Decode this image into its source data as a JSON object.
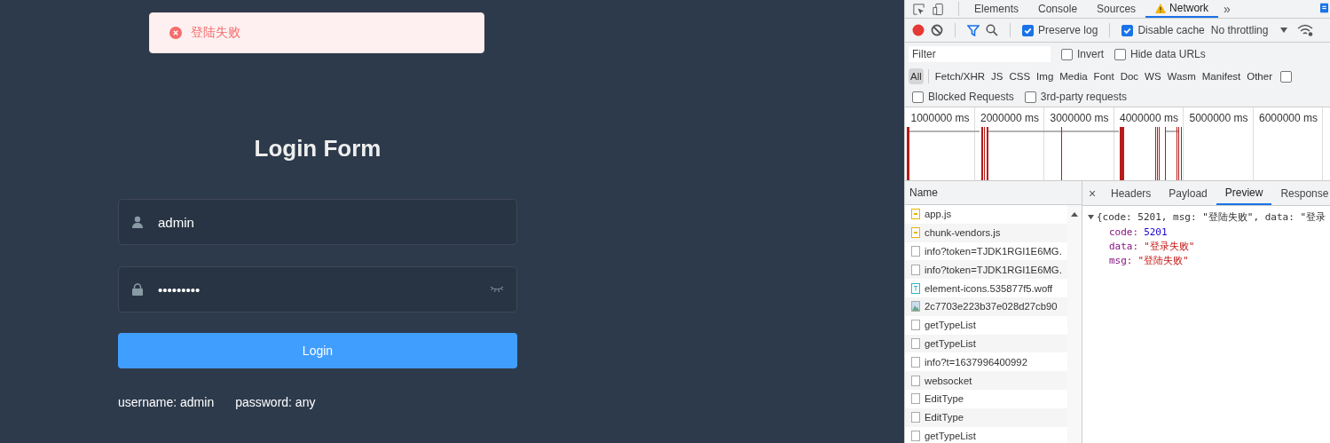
{
  "toast": {
    "kind": "error",
    "text": "登陆失败"
  },
  "login": {
    "title": "Login Form",
    "fields": [
      {
        "kind": "user",
        "value": "admin"
      },
      {
        "kind": "password",
        "value": "•••••••••",
        "show_toggle": true
      }
    ],
    "button": "Login",
    "hints": [
      "username: admin",
      "password: any"
    ]
  },
  "devtools": {
    "tabs": [
      {
        "label": "Elements",
        "selected": false,
        "warning": false
      },
      {
        "label": "Console",
        "selected": false,
        "warning": false
      },
      {
        "label": "Sources",
        "selected": false,
        "warning": false
      },
      {
        "label": "Network",
        "selected": true,
        "warning": true
      }
    ],
    "more_tabs": "»",
    "toolbar": {
      "recording": true,
      "preserve_log": {
        "label": "Preserve log",
        "checked": true
      },
      "disable_cache": {
        "label": "Disable cache",
        "checked": true
      },
      "throttling": "No throttling"
    },
    "filter": {
      "placeholder": "Filter",
      "invert": {
        "label": "Invert",
        "checked": false
      },
      "hide_data_urls": {
        "label": "Hide data URLs",
        "checked": false
      }
    },
    "types": [
      {
        "label": "All",
        "selected": true
      },
      {
        "label": "Fetch/XHR",
        "selected": false
      },
      {
        "label": "JS",
        "selected": false
      },
      {
        "label": "CSS",
        "selected": false
      },
      {
        "label": "Img",
        "selected": false
      },
      {
        "label": "Media",
        "selected": false
      },
      {
        "label": "Font",
        "selected": false
      },
      {
        "label": "Doc",
        "selected": false
      },
      {
        "label": "WS",
        "selected": false
      },
      {
        "label": "Wasm",
        "selected": false
      },
      {
        "label": "Manifest",
        "selected": false
      },
      {
        "label": "Other",
        "selected": false
      }
    ],
    "types_extra_checkbox": {
      "checked": false
    },
    "blocked": [
      {
        "label": "Blocked Requests",
        "checked": false
      },
      {
        "label": "3rd-party requests",
        "checked": false
      }
    ],
    "timeline_ticks": [
      "1000000 ms",
      "2000000 ms",
      "3000000 ms",
      "4000000 ms",
      "5000000 ms",
      "6000000 ms"
    ],
    "requests_header": "Name",
    "requests": [
      {
        "name": "app.js",
        "kind": "script"
      },
      {
        "name": "chunk-vendors.js",
        "kind": "script"
      },
      {
        "name": "info?token=TJDK1RGI1E6MG.",
        "kind": "doc"
      },
      {
        "name": "info?token=TJDK1RGI1E6MG.",
        "kind": "doc"
      },
      {
        "name": "element-icons.535877f5.woff",
        "kind": "font"
      },
      {
        "name": "2c7703e223b37e028d27cb90",
        "kind": "image"
      },
      {
        "name": "getTypeList",
        "kind": "doc"
      },
      {
        "name": "getTypeList",
        "kind": "doc"
      },
      {
        "name": "info?t=1637996400992",
        "kind": "doc"
      },
      {
        "name": "websocket",
        "kind": "doc"
      },
      {
        "name": "EditType",
        "kind": "doc"
      },
      {
        "name": "EditType",
        "kind": "doc"
      },
      {
        "name": "getTypeList",
        "kind": "doc"
      }
    ],
    "detail_close": "×",
    "detail_tabs": [
      {
        "label": "Headers",
        "selected": false
      },
      {
        "label": "Payload",
        "selected": false
      },
      {
        "label": "Preview",
        "selected": true
      },
      {
        "label": "Response",
        "selected": false
      }
    ],
    "preview": {
      "expanded": true,
      "summary": "{code: 5201, msg: \"登陆失败\", data: \"登录",
      "properties": [
        {
          "key": "code:",
          "value": "5201",
          "kind": "number"
        },
        {
          "key": "data:",
          "value": "\"登录失败\"",
          "kind": "string"
        },
        {
          "key": "msg:",
          "value": "\"登陆失败\"",
          "kind": "string"
        }
      ]
    }
  }
}
